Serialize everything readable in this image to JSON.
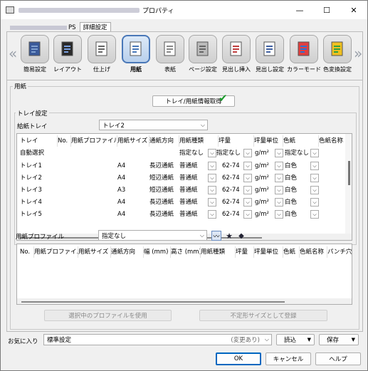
{
  "window": {
    "title_suffix": "プロパティ",
    "minimize": "—",
    "maximize": "☐",
    "close": "✕"
  },
  "tabs": [
    {
      "label": "PS"
    },
    {
      "label": "詳細設定"
    }
  ],
  "toolbar": {
    "items": [
      {
        "label": "簡易設定",
        "icon": "quick-setup-icon"
      },
      {
        "label": "レイアウト",
        "icon": "layout-icon"
      },
      {
        "label": "仕上げ",
        "icon": "finishing-icon"
      },
      {
        "label": "用紙",
        "icon": "paper-icon"
      },
      {
        "label": "表紙",
        "icon": "cover-icon"
      },
      {
        "label": "ページ設定",
        "icon": "page-setting-icon"
      },
      {
        "label": "見出し挿入",
        "icon": "tab-insert-icon"
      },
      {
        "label": "見出し設定",
        "icon": "tab-setting-icon"
      },
      {
        "label": "カラーモード",
        "icon": "color-mode-icon"
      },
      {
        "label": "色変換設定",
        "icon": "color-conversion-icon"
      }
    ],
    "left_arrow": "«",
    "right_arrow": "»"
  },
  "paper": {
    "group_title": "用紙",
    "tray_info_button": "トレイ/用紙情報取得",
    "check": "✔"
  },
  "tray": {
    "group_title": "トレイ設定",
    "feed_label": "給紙トレイ",
    "feed_value": "トレイ2",
    "columns": [
      "トレイ",
      "No.",
      "用紙プロファイル",
      "用紙サイズ",
      "通紙方向",
      "用紙種類",
      "坪量",
      "坪量単位",
      "色紙",
      "色紙名称"
    ],
    "auto_row": {
      "name": "自動選択",
      "type": "指定なし",
      "weight": "指定なし",
      "unit": "g/m²",
      "color": "指定なし"
    },
    "rows": [
      {
        "tray": "トレイ1",
        "size": "A4",
        "dir": "長辺通紙",
        "type": "普通紙",
        "weight": "62-74",
        "unit": "g/m²",
        "color": "白色"
      },
      {
        "tray": "トレイ2",
        "size": "A4",
        "dir": "短辺通紙",
        "type": "普通紙",
        "weight": "62-74",
        "unit": "g/m²",
        "color": "白色"
      },
      {
        "tray": "トレイ3",
        "size": "A3",
        "dir": "短辺通紙",
        "type": "普通紙",
        "weight": "62-74",
        "unit": "g/m²",
        "color": "白色"
      },
      {
        "tray": "トレイ4",
        "size": "A4",
        "dir": "長辺通紙",
        "type": "普通紙",
        "weight": "62-74",
        "unit": "g/m²",
        "color": "白色"
      },
      {
        "tray": "トレイ5",
        "size": "A4",
        "dir": "長辺通紙",
        "type": "普通紙",
        "weight": "62-74",
        "unit": "g/m²",
        "color": "白色"
      }
    ]
  },
  "profile": {
    "label": "用紙プロファイル",
    "value": "指定なし",
    "columns": [
      "No.",
      "用紙プロファイル",
      "用紙サイズ",
      "通紙方向",
      "幅 (mm)",
      "高さ (mm)",
      "用紙種類",
      "坪量",
      "坪量単位",
      "色紙",
      "色紙名称",
      "パンチ穴"
    ],
    "use_button": "選択中のプロファイルを使用",
    "register_button": "不定形サイズとして登録"
  },
  "favorites": {
    "label": "お気に入り",
    "value": "標準設定",
    "changed": "(変更あり)",
    "load": "読込",
    "save": "保存"
  },
  "footer": {
    "ok": "OK",
    "cancel": "キャンセル",
    "help": "ヘルプ"
  },
  "colors": {
    "accent": "#4a78b8",
    "check": "#1a9a2a"
  }
}
